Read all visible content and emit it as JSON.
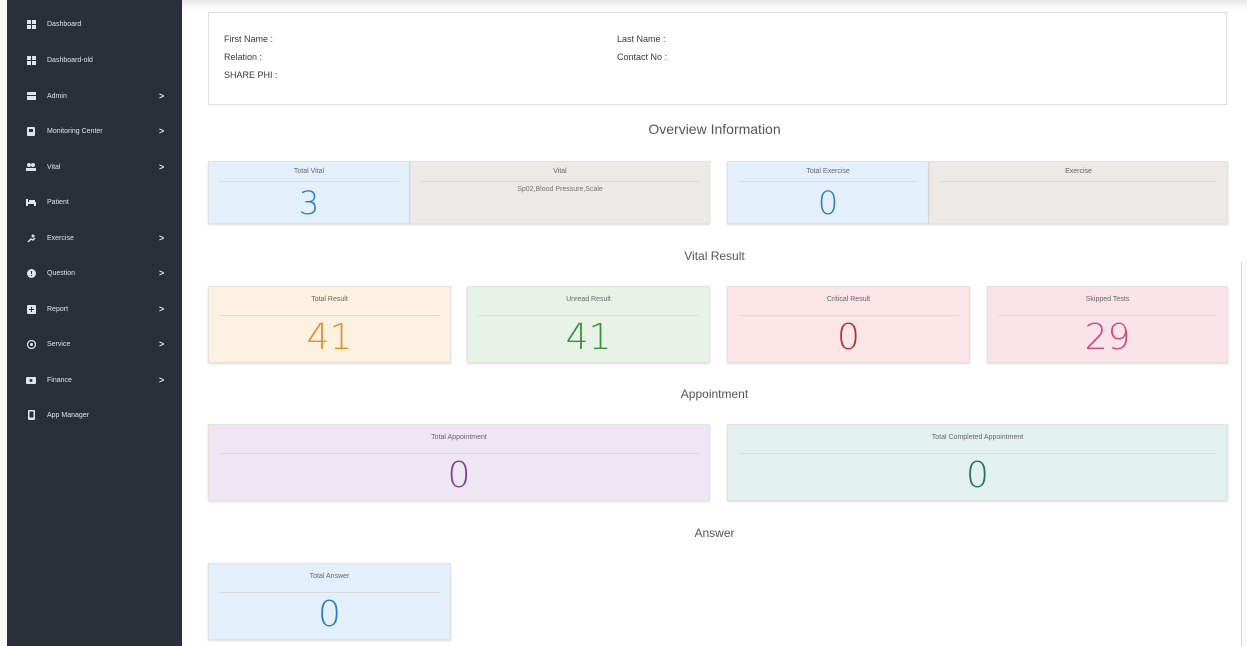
{
  "sidebar": {
    "items": [
      {
        "label": "Dashboard",
        "icon": "dashboard-icon",
        "chevron": ""
      },
      {
        "label": "Dashboard-old",
        "icon": "dashboard-icon",
        "chevron": ""
      },
      {
        "label": "Admin",
        "icon": "admin-icon",
        "chevron": ">"
      },
      {
        "label": "Monitoring Center",
        "icon": "monitor-icon",
        "chevron": ">"
      },
      {
        "label": "Vital",
        "icon": "vital-icon",
        "chevron": ">"
      },
      {
        "label": "Patient",
        "icon": "bed-icon",
        "chevron": ""
      },
      {
        "label": "Exercise",
        "icon": "exercise-icon",
        "chevron": ">"
      },
      {
        "label": "Question",
        "icon": "question-icon",
        "chevron": ">"
      },
      {
        "label": "Report",
        "icon": "report-icon",
        "chevron": ">"
      },
      {
        "label": "Service",
        "icon": "service-icon",
        "chevron": ">"
      },
      {
        "label": "Finance",
        "icon": "finance-icon",
        "chevron": ">"
      },
      {
        "label": "App Manager",
        "icon": "phone-icon",
        "chevron": ""
      }
    ]
  },
  "profile": {
    "first_name_label": "First Name :",
    "last_name_label": "Last Name :",
    "relation_label": "Relation :",
    "contact_label": "Contact No :",
    "share_phi_label": "SHARE PHI :"
  },
  "overview": {
    "title": "Overview Information",
    "total_vital_label": "Total Vital",
    "total_vital_value": "3",
    "vital_label": "Vital",
    "vital_text": "Sp02,Blood Pressure,Scale",
    "total_exercise_label": "Total Exercise",
    "total_exercise_value": "0",
    "exercise_label": "Exercise"
  },
  "vital_result": {
    "title": "Vital Result",
    "total_result_label": "Total Result",
    "total_result_value": "41",
    "unread_result_label": "Unread Result",
    "unread_result_value": "41",
    "critical_result_label": "Critical Result",
    "critical_result_value": "0",
    "skipped_tests_label": "Skipped Tests",
    "skipped_tests_value": "29"
  },
  "appointment": {
    "title": "Appointment",
    "total_label": "Total Appointment",
    "total_value": "0",
    "completed_label": "Total Completed Appointment",
    "completed_value": "0"
  },
  "answer": {
    "title": "Answer",
    "total_label": "Total Answer",
    "total_value": "0"
  },
  "colors": {
    "sidebar_bg": "#2b2f3a",
    "blue_card": "#e3f0fb",
    "grey_card": "#ece9e7",
    "orange_card": "#fdf1e0",
    "green_card": "#e6f3e6",
    "pink_card": "#fbe5e7",
    "magenta_card": "#fbe3ea",
    "purple_card": "#eee6f3",
    "teal_card": "#e2f1ee",
    "blue_value": "#2f7bbf",
    "orange_value": "#e4902e",
    "green_value": "#3c8f3f",
    "red_value": "#b23030",
    "magenta_value": "#d0477b",
    "purple_value": "#7d3f98",
    "teal_value": "#2a6e5e"
  }
}
